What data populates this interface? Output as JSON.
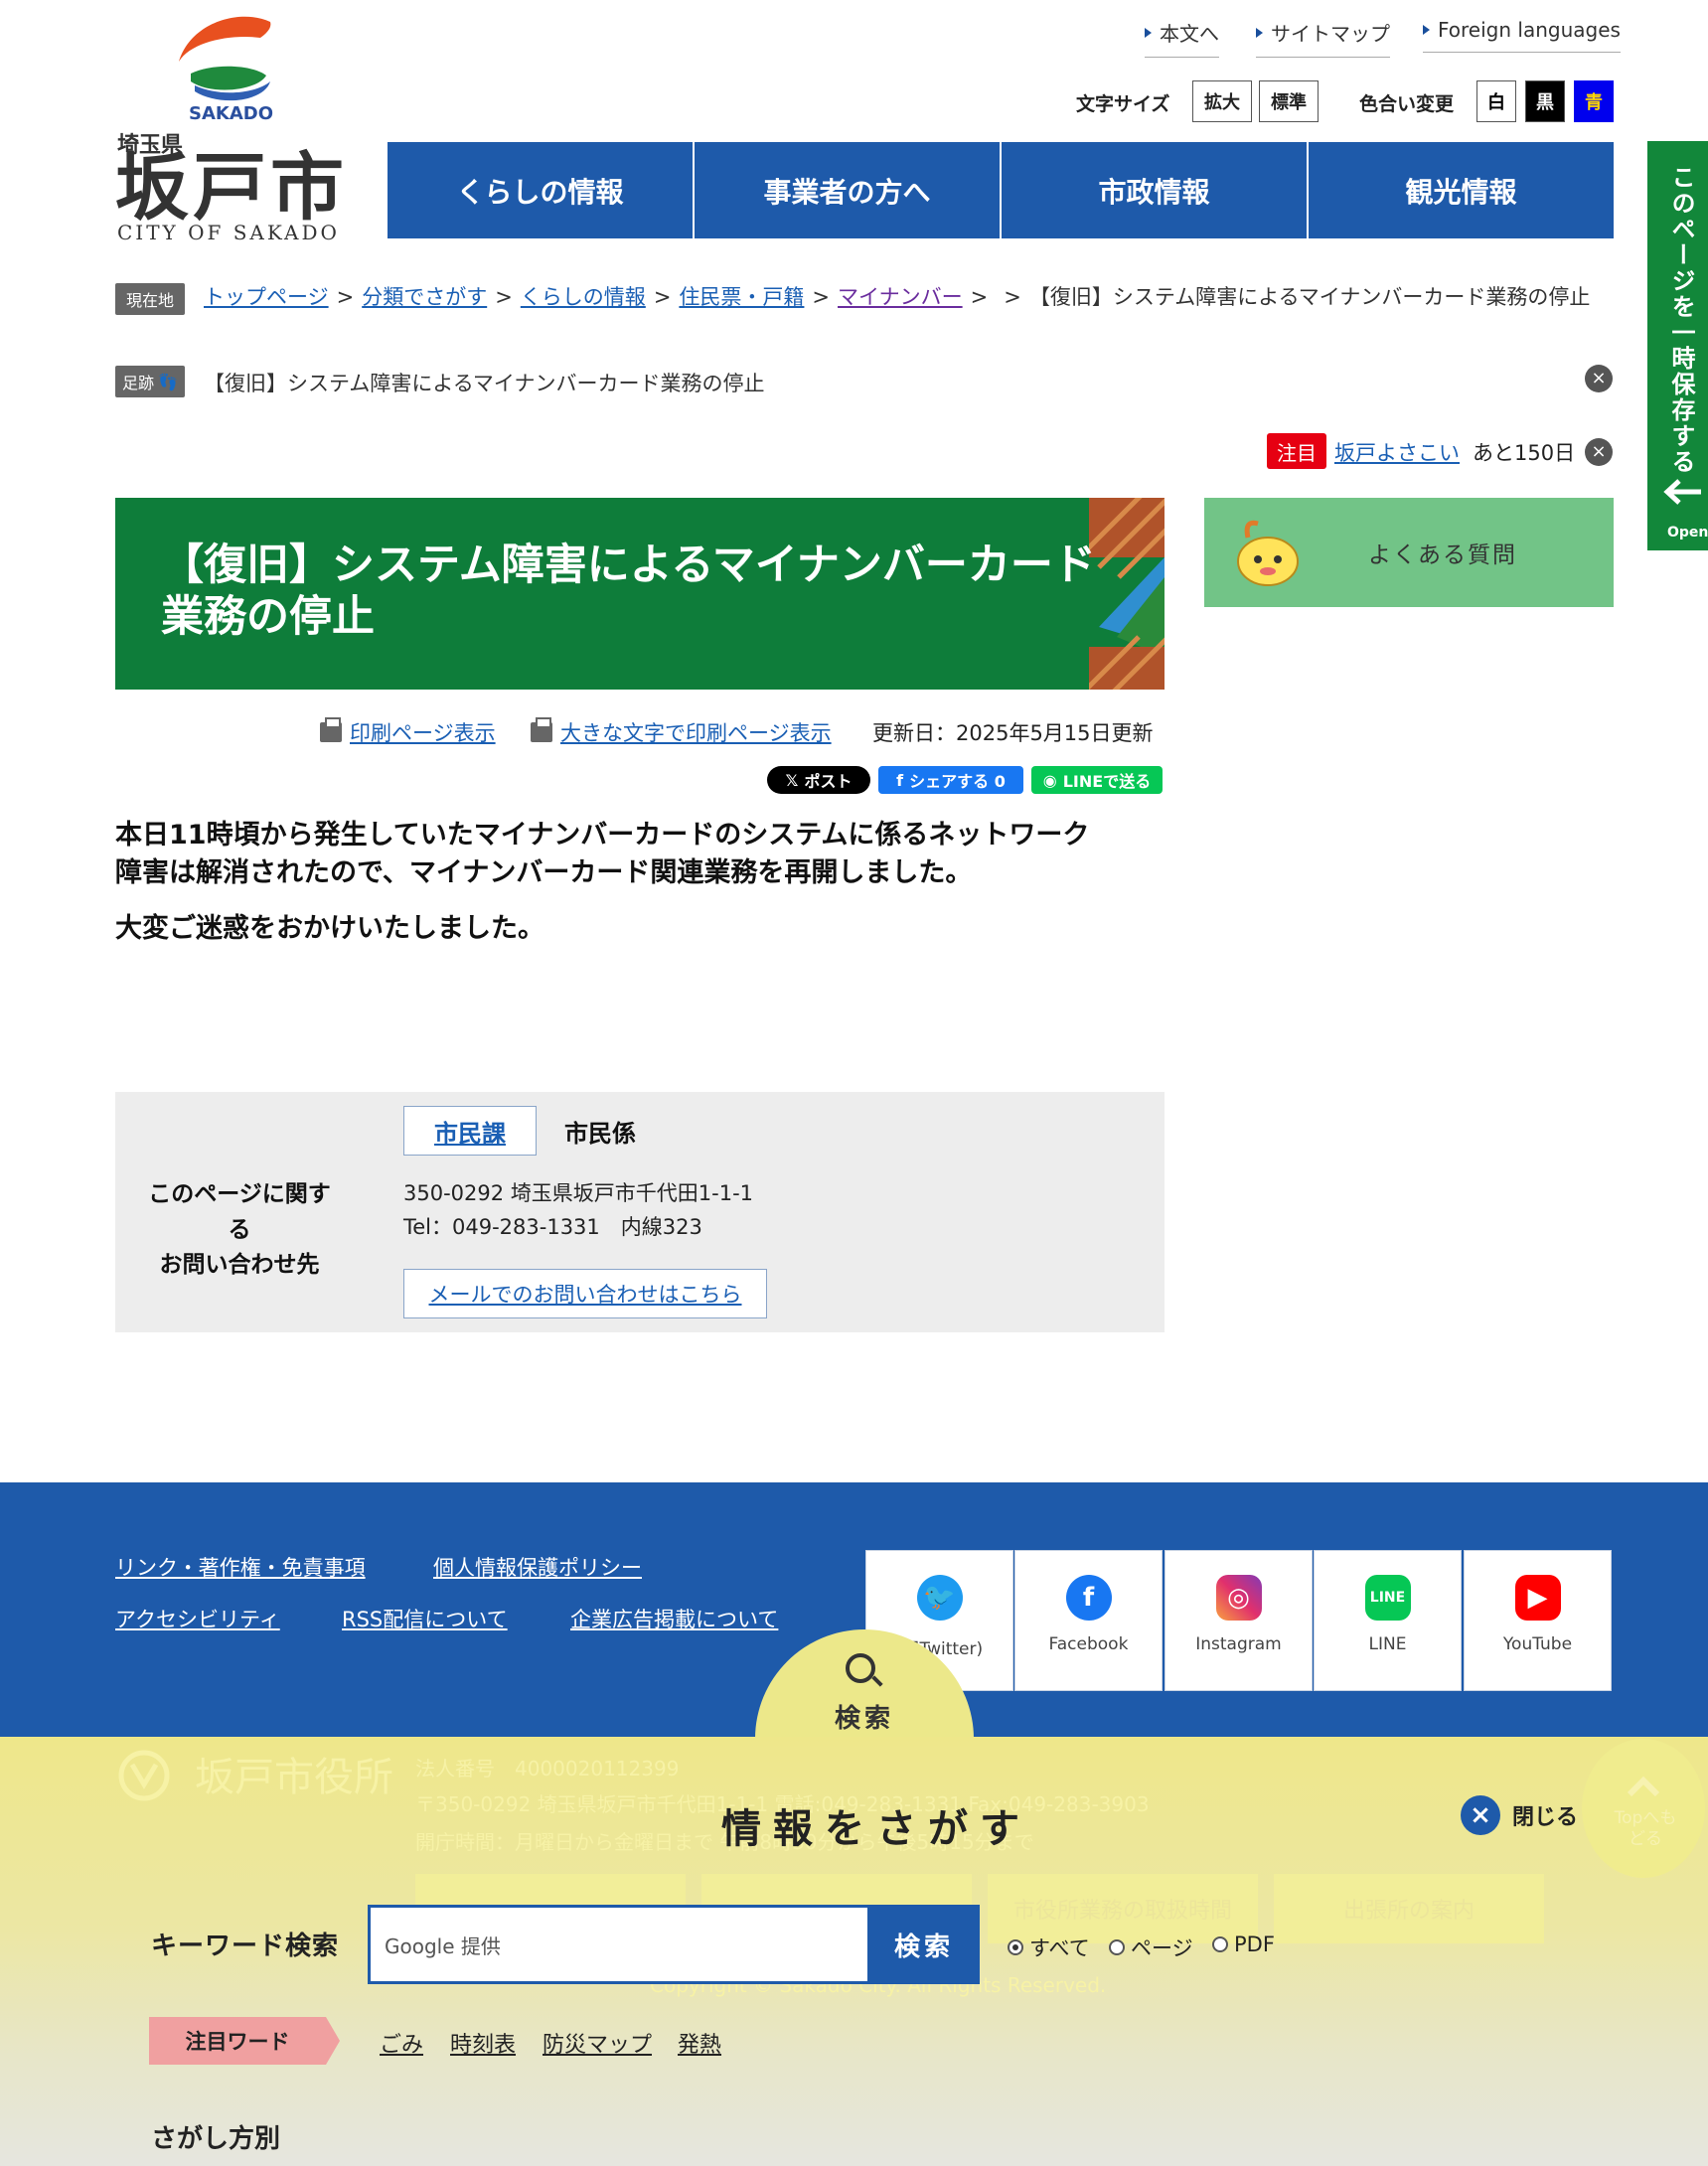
{
  "header": {
    "utility_links": [
      "本文へ",
      "サイトマップ",
      "Foreign languages"
    ],
    "font_size_label": "文字サイズ",
    "font_size_buttons": [
      "拡大",
      "標準"
    ],
    "color_label": "色合い変更",
    "color_buttons": [
      "白",
      "黒",
      "青"
    ],
    "logo": {
      "sakado": "SAKADO",
      "prefecture": "埼玉県",
      "city": "坂戸市",
      "english": "CITY OF SAKADO"
    }
  },
  "global_nav": [
    "くらしの情報",
    "事業者の方へ",
    "市政情報",
    "観光情報"
  ],
  "side_tab": {
    "label": "このページを一時保存する",
    "open": "Open"
  },
  "breadcrumb": {
    "tag": "現在地",
    "items": [
      "トップページ",
      "分類でさがす",
      "くらしの情報",
      "住民票・戸籍",
      "マイナンバー"
    ],
    "separator": ">",
    "current": "【復旧】システム障害によるマイナンバーカード業務の停止"
  },
  "footprints": {
    "tag": "足跡",
    "text": "【復旧】システム障害によるマイナンバーカード業務の停止"
  },
  "notice": {
    "badge": "注目",
    "link": "坂戸よさこい",
    "rest": "あと150日"
  },
  "page": {
    "title_line1": "【復旧】システム障害によるマイナンバーカード",
    "title_line2": "業務の停止",
    "print_link": "印刷ページ表示",
    "print_large_link": "大きな文字で印刷ページ表示",
    "updated": "更新日：2025年5月15日更新",
    "share_buttons": [
      "ポスト",
      "シェアする 0",
      "LINEで送る"
    ],
    "body_line1": "本日11時頃から発生していたマイナンバーカードのシステムに係るネットワーク",
    "body_line2": "障害は解消されたので、マイナンバーカード関連業務を再開しました。",
    "body_para2": "大変ご迷惑をおかけいたしました。"
  },
  "faq": {
    "label": "よくある質問"
  },
  "contact": {
    "heading_line1": "このページに関する",
    "heading_line2": "お問い合わせ先",
    "department": "市民課",
    "section": "市民係",
    "address": "350-0292 埼玉県坂戸市千代田1-1-1",
    "tel": "Tel：049-283-1331　内線323",
    "mail_button": "メールでのお問い合わせはこちら"
  },
  "footer": {
    "links_row1": [
      "リンク・著作権・免責事項",
      "個人情報保護ポリシー"
    ],
    "links_row2": [
      "アクセシビリティ",
      "RSS配信について",
      "企業広告掲載について"
    ],
    "sns": [
      {
        "label": "(旧Twitter)",
        "color": "#1d9bf0"
      },
      {
        "label": "Facebook",
        "color": "#1877f2"
      },
      {
        "label": "Instagram",
        "color": "#e1306c"
      },
      {
        "label": "LINE",
        "color": "#06c755"
      },
      {
        "label": "YouTube",
        "color": "#ff0000"
      }
    ],
    "office_name": "坂戸市役所",
    "corporate_number": "法人番号　4000020112399",
    "address_line": "〒350-0292 埼玉県坂戸市千代田1-1-1 電話:049-283-1331 Fax:049-283-3903",
    "hours": "開庁時間：月曜日から金曜日まで 午前8時30分から午後5時15分まで",
    "buttons": [
      "",
      "",
      "市役所業務の取扱時間",
      "出張所の案内"
    ],
    "copyright": "Copyright © Sakado City. All Rights Reserved.",
    "to_top": "Topへもどる"
  },
  "search_overlay": {
    "tab_label": "検索",
    "title": "情報をさがす",
    "close": "閉じる",
    "keyword_label": "キーワード検索",
    "input_placeholder": "Google 提供",
    "submit": "検索",
    "radio_options": [
      "すべて",
      "ページ",
      "PDF"
    ],
    "selected": "すべて",
    "hotword_label": "注目ワード",
    "hotwords": [
      "ごみ",
      "時刻表",
      "防災マップ",
      "発熱"
    ],
    "method_label": "さがし方別"
  },
  "colors": {
    "nav_blue": "#1e5aaa",
    "title_green": "#0e7d3a",
    "side_tab_green": "#12873a",
    "faq_green": "#72c487",
    "notice_red": "#e60012"
  }
}
